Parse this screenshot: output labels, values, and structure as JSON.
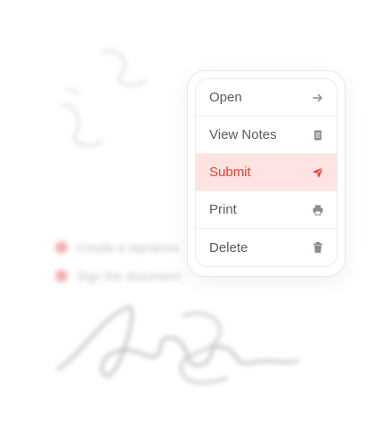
{
  "background": {
    "tasks": [
      {
        "label": "Create a signature"
      },
      {
        "label": "Sign the document"
      }
    ]
  },
  "menu": {
    "items": [
      {
        "label": "Open",
        "icon": "arrow-right-icon"
      },
      {
        "label": "View Notes",
        "icon": "notes-icon"
      },
      {
        "label": "Submit",
        "icon": "send-icon",
        "active": true
      },
      {
        "label": "Print",
        "icon": "printer-icon"
      },
      {
        "label": "Delete",
        "icon": "trash-icon"
      }
    ]
  },
  "colors": {
    "accent": "#e8402f",
    "active_bg": "#fde4e3",
    "text": "#5a5a64",
    "icon": "#8a8a94"
  }
}
